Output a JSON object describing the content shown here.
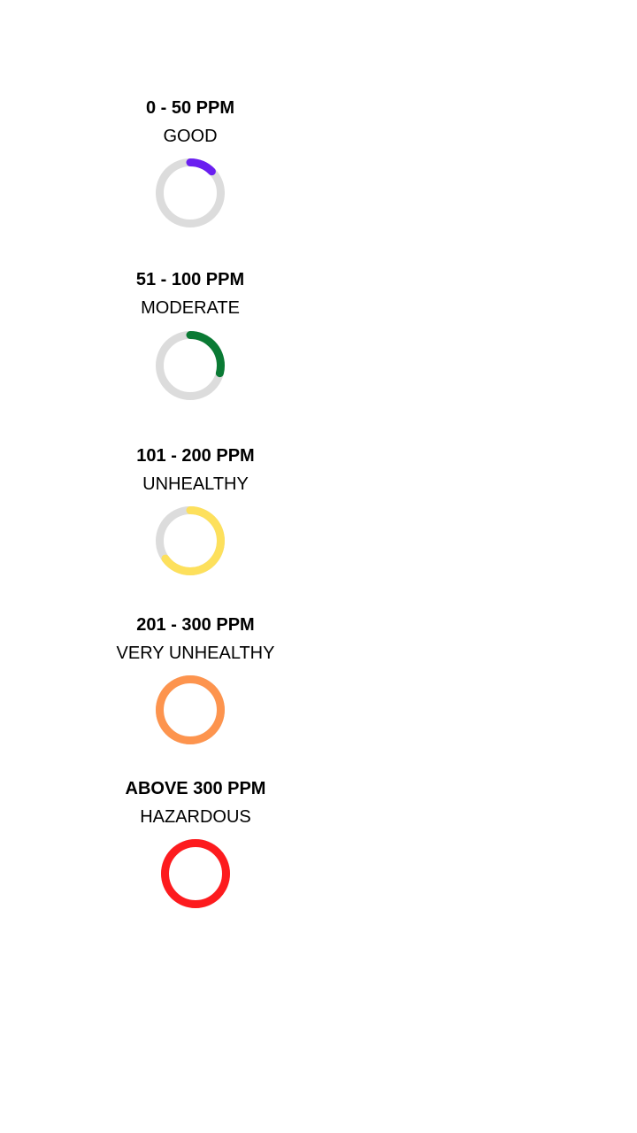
{
  "levels": [
    {
      "range": "0 - 50 PPM",
      "label": "GOOD",
      "fill": 0.125,
      "color": "#6a1ff0",
      "track": "#dcdcdc",
      "icon": "progress-ring-icon"
    },
    {
      "range": "51 - 100 PPM",
      "label": "MODERATE",
      "fill": 0.29,
      "color": "#0a7a34",
      "track": "#dcdcdc",
      "icon": "progress-ring-icon"
    },
    {
      "range": "101 - 200 PPM",
      "label": "UNHEALTHY",
      "fill": 0.65,
      "color": "#fde05c",
      "track": "#dcdcdc",
      "icon": "progress-ring-icon"
    },
    {
      "range": "201 - 300 PPM",
      "label": "VERY UNHEALTHY",
      "fill": 1.0,
      "color": "#fd944e",
      "track": "#dcdcdc",
      "icon": "progress-ring-icon"
    },
    {
      "range": "ABOVE 300 PPM",
      "label": "HAZARDOUS",
      "fill": 1.0,
      "color": "#fd1b1e",
      "track": "#dcdcdc",
      "icon": "progress-ring-icon"
    }
  ]
}
